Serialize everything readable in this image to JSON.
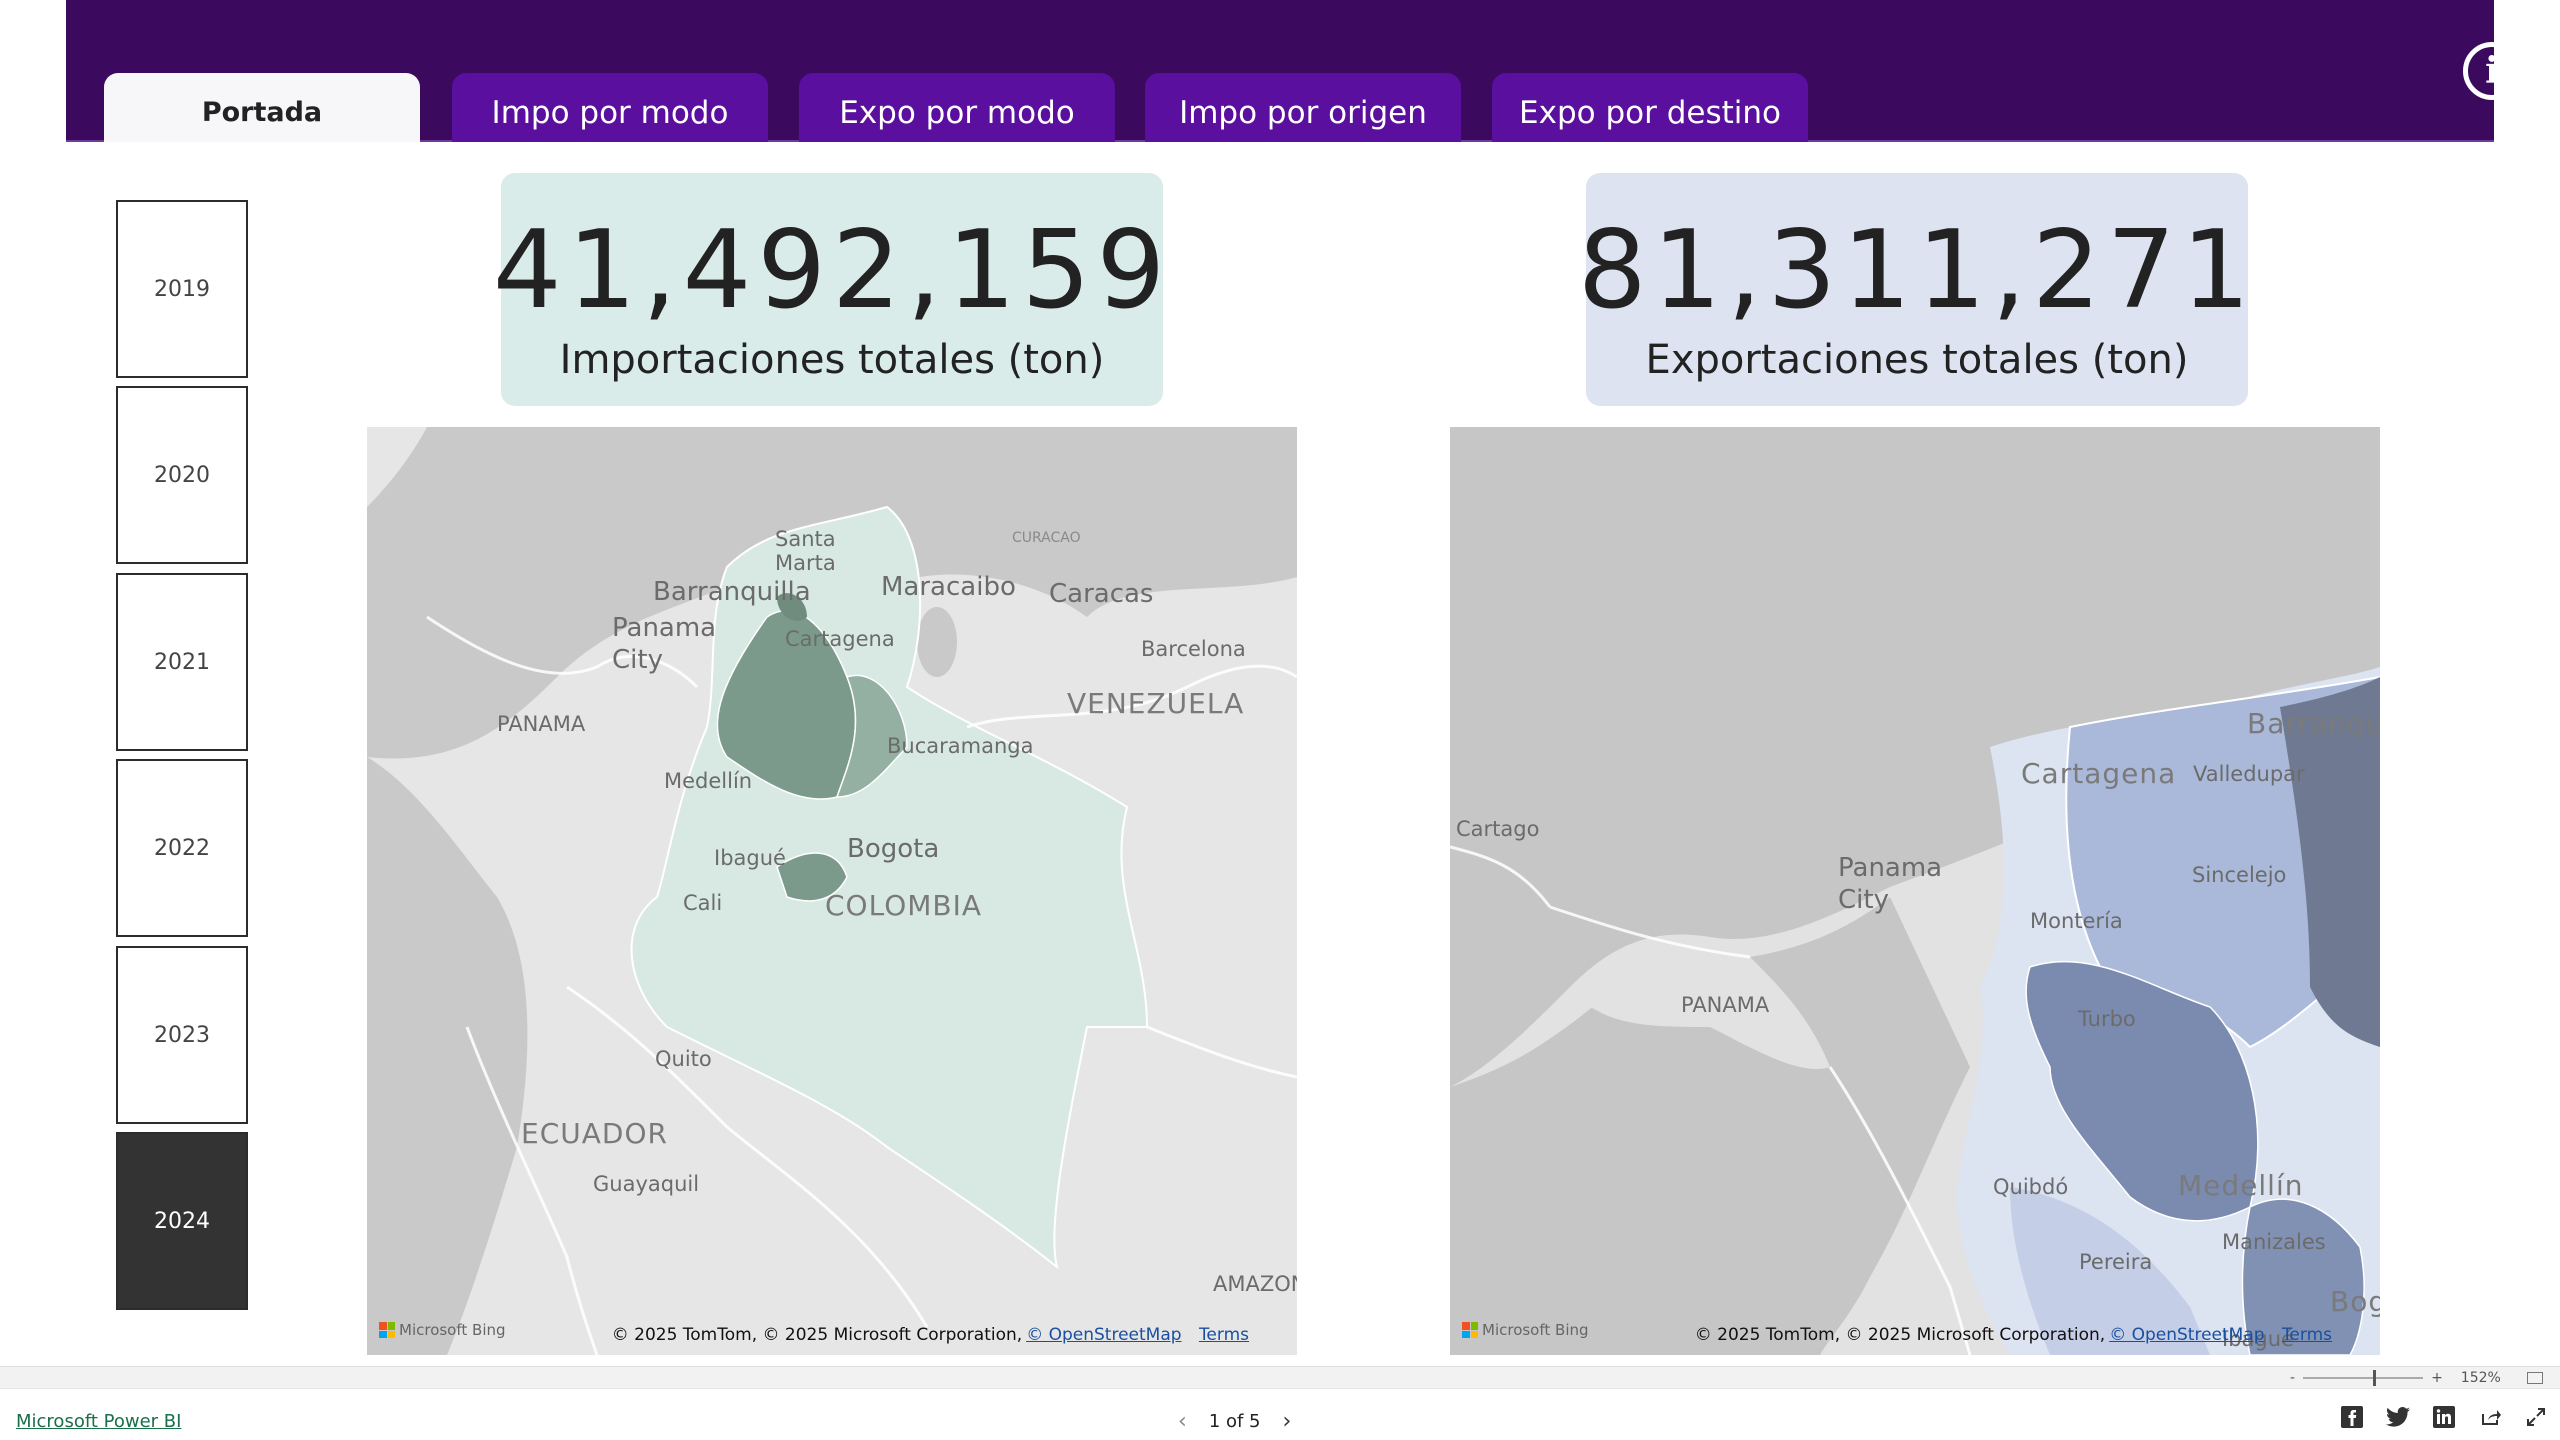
{
  "tabs": [
    {
      "label": "Portada",
      "active": true
    },
    {
      "label": "Impo por modo",
      "active": false
    },
    {
      "label": "Expo por modo",
      "active": false
    },
    {
      "label": "Impo por origen",
      "active": false
    },
    {
      "label": "Expo por destino",
      "active": false
    }
  ],
  "years": [
    {
      "label": "2019",
      "selected": false
    },
    {
      "label": "2020",
      "selected": false
    },
    {
      "label": "2021",
      "selected": false
    },
    {
      "label": "2022",
      "selected": false
    },
    {
      "label": "2023",
      "selected": false
    },
    {
      "label": "2024",
      "selected": true
    }
  ],
  "kpis": {
    "imports": {
      "value": "41,492,159",
      "label": "Importaciones totales (ton)",
      "color": "#daecea"
    },
    "exports": {
      "value": "81,311,271",
      "label": "Exportaciones totales (ton)",
      "color": "#dde3f1"
    }
  },
  "map_left": {
    "labels": [
      "Santa",
      "Marta",
      "CURACAO",
      "Barranquilla",
      "Maracaibo",
      "Caracas",
      "Panama",
      "City",
      "Cartagena",
      "Barcelona",
      "PANAMA",
      "VENEZUELA",
      "Bucaramanga",
      "Medellín",
      "Ibagué",
      "Bogota",
      "COLOMBIA",
      "Cali",
      "Quito",
      "ECUADOR",
      "Guayaquil",
      "AMAZON"
    ]
  },
  "map_right": {
    "labels": [
      "Barranqu",
      "Cartagena",
      "Valledupar",
      "Cartago",
      "Panama",
      "City",
      "Sincelejo",
      "Montería",
      "PANAMA",
      "Turbo",
      "Quibdó",
      "Medellín",
      "Pereira",
      "Manizales",
      "Ibagué",
      "Bog"
    ]
  },
  "attribution": {
    "bing": "Microsoft Bing",
    "text": "© 2025 TomTom, © 2025 Microsoft Corporation,",
    "osm": "© OpenStreetMap",
    "terms": "Terms"
  },
  "zoom": {
    "minus": "-",
    "plus": "+",
    "level": "152%"
  },
  "footer": {
    "powerbi_link": "Microsoft Power BI",
    "page_indicator": "1 of 5"
  },
  "colors": {
    "header": "#3b0a5e",
    "tab": "#5a0f9e",
    "import_fill": "#d7e9e2",
    "import_dark": "#6f8c7f",
    "export_fill": "#a9b8d8",
    "export_dark": "#7787a8"
  }
}
